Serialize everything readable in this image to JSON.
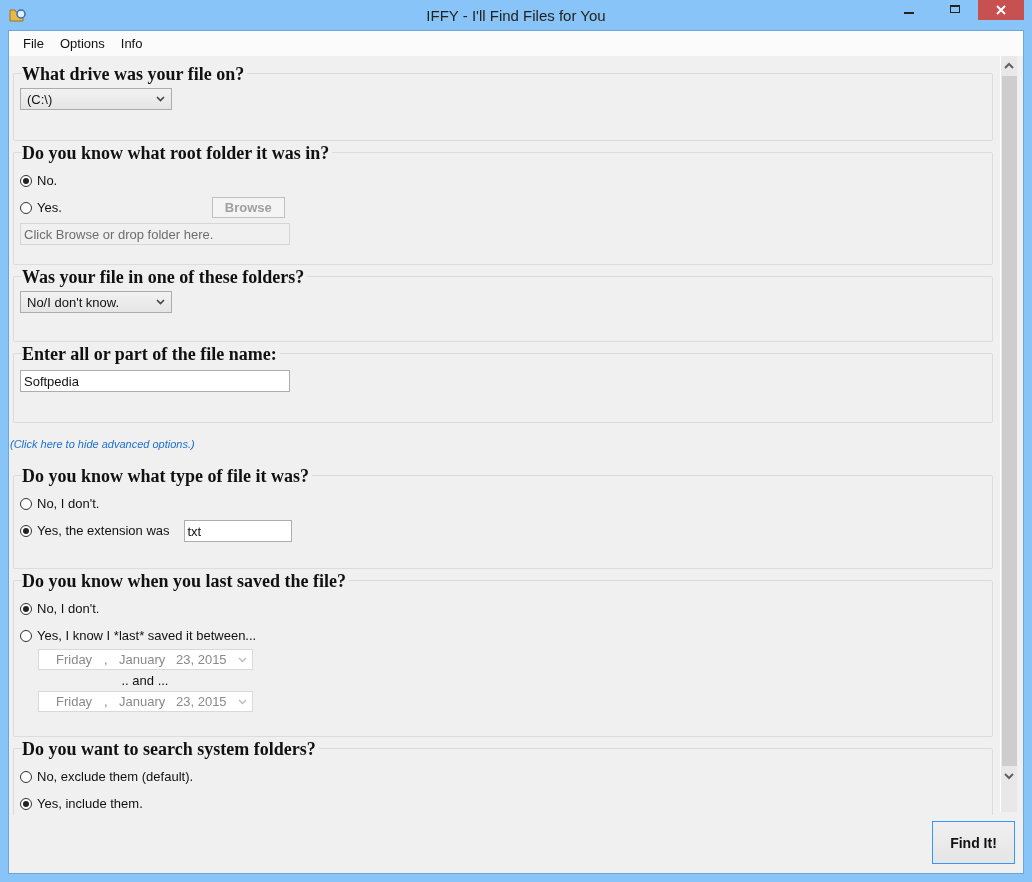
{
  "window": {
    "title": "IFFY - I'll Find Files for You"
  },
  "menu": [
    "File",
    "Options",
    "Info"
  ],
  "basic_sections": [
    {
      "title": "What drive was your file on?",
      "items": [
        {
          "kind": "dropdown",
          "value": "(C:\\)"
        }
      ]
    },
    {
      "title": "Do you know what root folder it was in?",
      "items": [
        {
          "kind": "radio",
          "label": "No.",
          "selected": true
        },
        {
          "kind": "radio",
          "label": "Yes.",
          "selected": false,
          "button": {
            "label": "Browse",
            "disabled": true
          }
        },
        {
          "kind": "field",
          "placeholder": "Click Browse or drop folder here.",
          "disabled": true
        }
      ]
    },
    {
      "title": "Was your file in one of these folders?",
      "items": [
        {
          "kind": "dropdown",
          "value": "No/I don't know."
        }
      ]
    },
    {
      "title": "Enter all or part of the file name:",
      "items": [
        {
          "kind": "field",
          "value": "Softpedia",
          "disabled": false
        }
      ]
    }
  ],
  "advanced_link": "(Click here to hide advanced options.)",
  "advanced_sections": [
    {
      "title": "Do you know what type of file it was?",
      "items": [
        {
          "kind": "radio",
          "label": "No, I don't.",
          "selected": false
        },
        {
          "kind": "radio",
          "label": "Yes, the extension was",
          "selected": true,
          "field": {
            "value": "txt"
          }
        }
      ]
    },
    {
      "title": "Do you know when you last saved the file?",
      "items": [
        {
          "kind": "radio",
          "label": "No, I don't.",
          "selected": true
        },
        {
          "kind": "radio",
          "label": "Yes, I know I *last* saved it between...",
          "selected": false
        },
        {
          "kind": "date",
          "weekday": "Friday",
          "separator": ",",
          "month": "January",
          "date": "23, 2015",
          "disabled": true
        },
        {
          "kind": "text",
          "text": ".. and ..."
        },
        {
          "kind": "date",
          "weekday": "Friday",
          "separator": ",",
          "month": "January",
          "date": "23, 2015",
          "disabled": true
        }
      ]
    },
    {
      "title": "Do you want to search system folders?",
      "items": [
        {
          "kind": "radio",
          "label": "No, exclude them (default).",
          "selected": false
        },
        {
          "kind": "radio",
          "label": "Yes, include them.",
          "selected": true
        }
      ]
    }
  ],
  "find_button": "Find It!"
}
